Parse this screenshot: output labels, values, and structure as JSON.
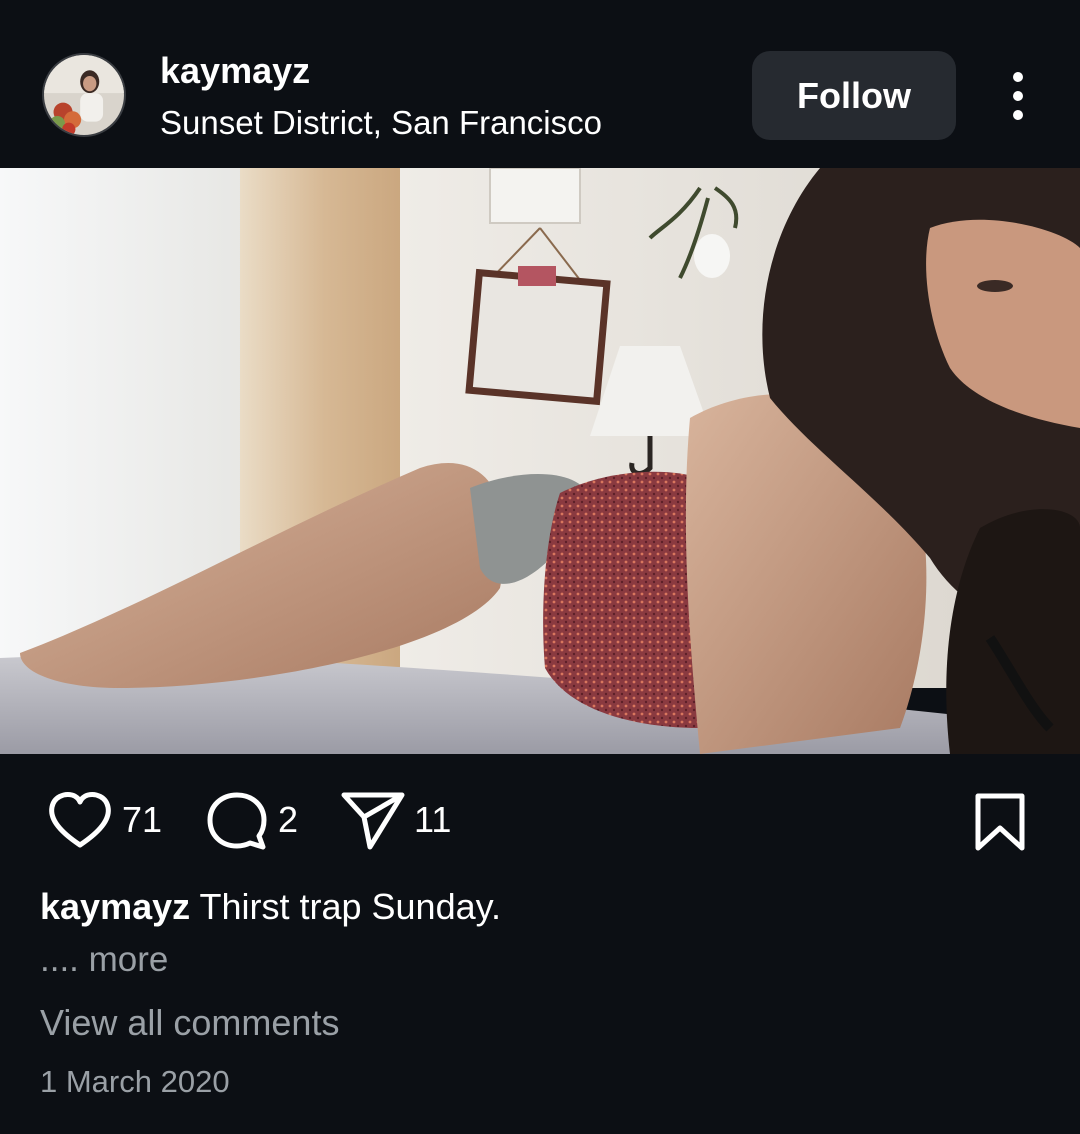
{
  "header": {
    "username": "kaymayz",
    "location": "Sunset District, San Francisco",
    "follow_label": "Follow",
    "avatar_icon": "profile-photo",
    "menu_icon": "more-vertical-icon"
  },
  "photo": {
    "subject": "photo-post-image"
  },
  "actions": {
    "likes": "71",
    "comments": "2",
    "shares": "11",
    "icons": [
      "heart-icon",
      "comment-bubble-icon",
      "send-icon",
      "bookmark-icon"
    ]
  },
  "caption": {
    "username": "kaymayz",
    "text": " Thirst trap Sunday.",
    "more": ".... more"
  },
  "footer": {
    "view_comments": "View all comments",
    "date": "1 March 2020"
  },
  "colors": {
    "background": "#0c0f14",
    "button": "#262a30",
    "muted_text": "#9aa0a6"
  }
}
